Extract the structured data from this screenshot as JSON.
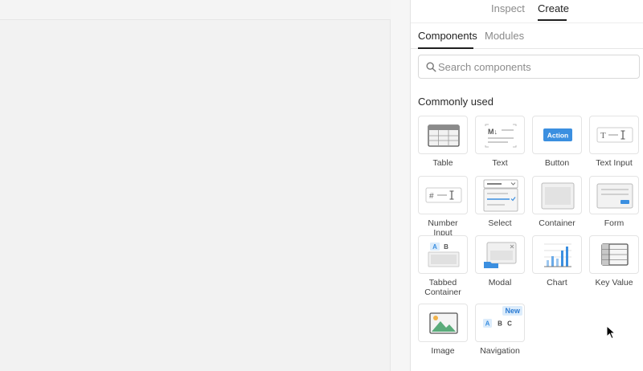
{
  "header": {
    "tabs": [
      {
        "label": "Inspect",
        "active": false
      },
      {
        "label": "Create",
        "active": true
      }
    ]
  },
  "subtabs": [
    {
      "label": "Components",
      "active": true
    },
    {
      "label": "Modules",
      "active": false
    }
  ],
  "search": {
    "placeholder": "Search components",
    "value": ""
  },
  "section": {
    "title": "Commonly used"
  },
  "components": [
    {
      "label": "Table",
      "icon": "table-icon"
    },
    {
      "label": "Text",
      "icon": "markdown-text-icon"
    },
    {
      "label": "Button",
      "icon": "button-icon",
      "button_text": "Action"
    },
    {
      "label": "Text Input",
      "icon": "text-input-icon",
      "glyph": "T"
    },
    {
      "label": "Number Input",
      "icon": "number-input-icon",
      "glyph": "#"
    },
    {
      "label": "Select",
      "icon": "select-icon"
    },
    {
      "label": "Container",
      "icon": "container-icon"
    },
    {
      "label": "Form",
      "icon": "form-icon"
    },
    {
      "label": "Tabbed Container",
      "icon": "tabbed-container-icon",
      "tabs": [
        "A",
        "B"
      ]
    },
    {
      "label": "Modal",
      "icon": "modal-icon"
    },
    {
      "label": "Chart",
      "icon": "chart-icon"
    },
    {
      "label": "Key Value",
      "icon": "key-value-icon"
    },
    {
      "label": "Image",
      "icon": "image-icon"
    },
    {
      "label": "Navigation",
      "icon": "navigation-icon",
      "badge": "New",
      "letters": [
        "A",
        "B",
        "C"
      ]
    }
  ],
  "colors": {
    "accent": "#3b8fe0",
    "accent_light": "#dcecfb",
    "border": "#e4e4e4"
  }
}
